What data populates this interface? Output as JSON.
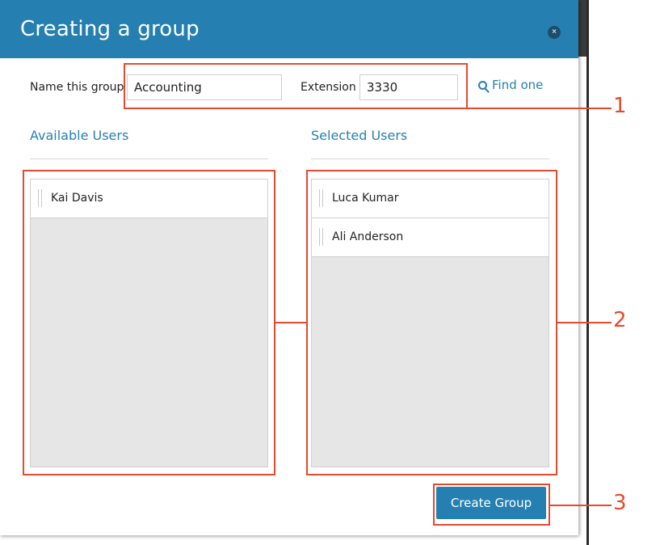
{
  "modal": {
    "title": "Creating a group",
    "close_icon": "×"
  },
  "form": {
    "name_label": "Name this group",
    "name_value": "Accounting",
    "extension_label": "Extension",
    "extension_value": "3330",
    "find_label": "Find one"
  },
  "available": {
    "title": "Available Users",
    "items": [
      {
        "label": "Kai Davis"
      }
    ]
  },
  "selected": {
    "title": "Selected Users",
    "items": [
      {
        "label": "Luca Kumar"
      },
      {
        "label": "Ali Anderson"
      }
    ]
  },
  "footer": {
    "create_label": "Create Group"
  },
  "annotations": {
    "one": "1",
    "two": "2",
    "three": "3"
  },
  "colors": {
    "accent": "#2580b1",
    "annotation": "#e64a2e"
  }
}
